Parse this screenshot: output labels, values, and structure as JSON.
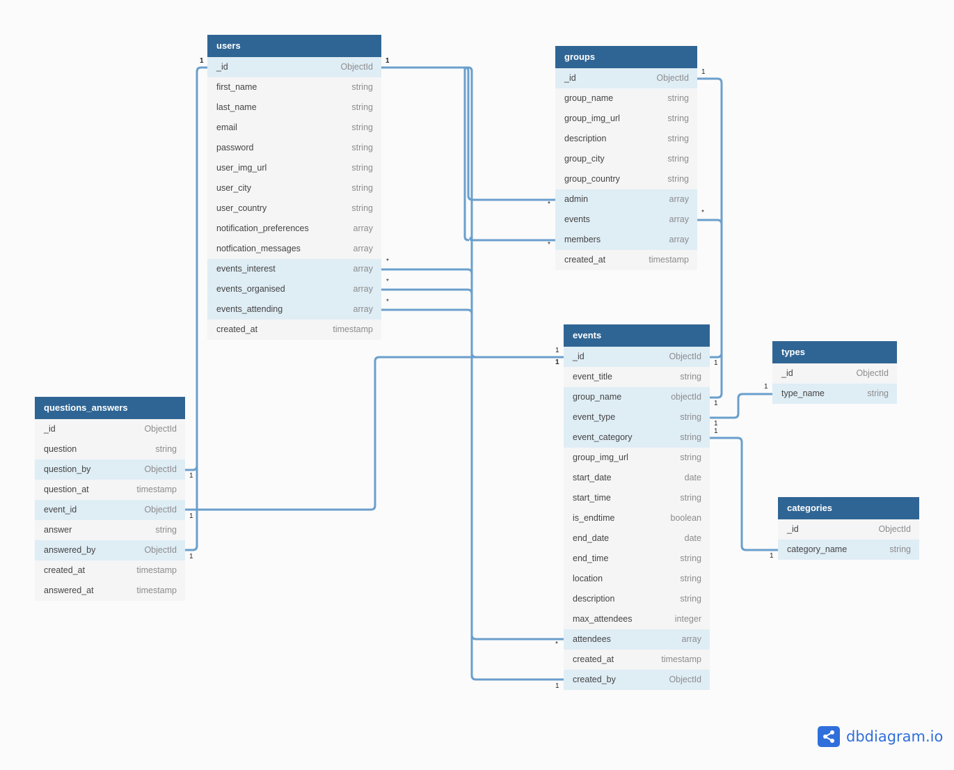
{
  "app": {
    "brand": "dbdiagram.io"
  },
  "colors": {
    "header": "#2f6594",
    "highlight_row": "#dfedf5",
    "link": "#6a9fcc",
    "brand": "#2f6fdb"
  },
  "tables": {
    "users": {
      "name": "users",
      "fields": [
        {
          "name": "_id",
          "type": "ObjectId",
          "hl": true
        },
        {
          "name": "first_name",
          "type": "string"
        },
        {
          "name": "last_name",
          "type": "string"
        },
        {
          "name": "email",
          "type": "string"
        },
        {
          "name": "password",
          "type": "string"
        },
        {
          "name": "user_img_url",
          "type": "string"
        },
        {
          "name": "user_city",
          "type": "string"
        },
        {
          "name": "user_country",
          "type": "string"
        },
        {
          "name": "notification_preferences",
          "type": "array"
        },
        {
          "name": "notfication_messages",
          "type": "array"
        },
        {
          "name": "events_interest",
          "type": "array",
          "hl": true
        },
        {
          "name": "events_organised",
          "type": "array",
          "hl": true
        },
        {
          "name": "events_attending",
          "type": "array",
          "hl": true
        },
        {
          "name": "created_at",
          "type": "timestamp"
        }
      ]
    },
    "groups": {
      "name": "groups",
      "fields": [
        {
          "name": "_id",
          "type": "ObjectId",
          "hl": true
        },
        {
          "name": "group_name",
          "type": "string"
        },
        {
          "name": "group_img_url",
          "type": "string"
        },
        {
          "name": "description",
          "type": "string"
        },
        {
          "name": "group_city",
          "type": "string"
        },
        {
          "name": "group_country",
          "type": "string"
        },
        {
          "name": "admin",
          "type": "array",
          "hl": true
        },
        {
          "name": "events",
          "type": "array",
          "hl": true
        },
        {
          "name": "members",
          "type": "array",
          "hl": true
        },
        {
          "name": "created_at",
          "type": "timestamp"
        }
      ]
    },
    "events": {
      "name": "events",
      "fields": [
        {
          "name": "_id",
          "type": "ObjectId",
          "hl": true
        },
        {
          "name": "event_title",
          "type": "string"
        },
        {
          "name": "group_name",
          "type": "objectId",
          "hl": true
        },
        {
          "name": "event_type",
          "type": "string",
          "hl": true
        },
        {
          "name": "event_category",
          "type": "string",
          "hl": true
        },
        {
          "name": "group_img_url",
          "type": "string"
        },
        {
          "name": "start_date",
          "type": "date"
        },
        {
          "name": "start_time",
          "type": "string"
        },
        {
          "name": "is_endtime",
          "type": "boolean"
        },
        {
          "name": "end_date",
          "type": "date"
        },
        {
          "name": "end_time",
          "type": "string"
        },
        {
          "name": "location",
          "type": "string"
        },
        {
          "name": "description",
          "type": "string"
        },
        {
          "name": "max_attendees",
          "type": "integer"
        },
        {
          "name": "attendees",
          "type": "array",
          "hl": true
        },
        {
          "name": "created_at",
          "type": "timestamp"
        },
        {
          "name": "created_by",
          "type": "ObjectId",
          "hl": true
        }
      ]
    },
    "types": {
      "name": "types",
      "fields": [
        {
          "name": "_id",
          "type": "ObjectId"
        },
        {
          "name": "type_name",
          "type": "string",
          "hl": true
        }
      ]
    },
    "categories": {
      "name": "categories",
      "fields": [
        {
          "name": "_id",
          "type": "ObjectId"
        },
        {
          "name": "category_name",
          "type": "string",
          "hl": true
        }
      ]
    },
    "questions_answers": {
      "name": "questions_answers",
      "fields": [
        {
          "name": "_id",
          "type": "ObjectId"
        },
        {
          "name": "question",
          "type": "string"
        },
        {
          "name": "question_by",
          "type": "ObjectId",
          "hl": true
        },
        {
          "name": "question_at",
          "type": "timestamp"
        },
        {
          "name": "event_id",
          "type": "ObjectId",
          "hl": true
        },
        {
          "name": "answer",
          "type": "string"
        },
        {
          "name": "answered_by",
          "type": "ObjectId",
          "hl": true
        },
        {
          "name": "created_at",
          "type": "timestamp"
        },
        {
          "name": "answered_at",
          "type": "timestamp"
        }
      ]
    }
  },
  "relationships": [
    {
      "from": "users._id",
      "to": "groups.admin",
      "from_card": "1",
      "to_card": "*"
    },
    {
      "from": "users._id",
      "to": "groups.members",
      "from_card": "1",
      "to_card": "*"
    },
    {
      "from": "users._id",
      "to": "events.attendees",
      "from_card": "1",
      "to_card": "*"
    },
    {
      "from": "users._id",
      "to": "events.created_by",
      "from_card": "1",
      "to_card": "1"
    },
    {
      "from": "users._id",
      "to": "questions_answers.question_by",
      "from_card": "1",
      "to_card": "1"
    },
    {
      "from": "users._id",
      "to": "questions_answers.answered_by",
      "from_card": "1",
      "to_card": "1"
    },
    {
      "from": "users.events_interest",
      "to": "events._id",
      "from_card": "*",
      "to_card": "1"
    },
    {
      "from": "users.events_organised",
      "to": "events._id",
      "from_card": "*",
      "to_card": "1"
    },
    {
      "from": "users.events_attending",
      "to": "events._id",
      "from_card": "*",
      "to_card": "1"
    },
    {
      "from": "questions_answers.event_id",
      "to": "events._id",
      "from_card": "1",
      "to_card": "1"
    },
    {
      "from": "groups._id",
      "to": "events.group_name",
      "from_card": "1",
      "to_card": "1"
    },
    {
      "from": "groups.events",
      "to": "events._id",
      "from_card": "*",
      "to_card": "1"
    },
    {
      "from": "events.event_type",
      "to": "types.type_name",
      "from_card": "1",
      "to_card": "1"
    },
    {
      "from": "events.event_category",
      "to": "categories.category_name",
      "from_card": "1",
      "to_card": "1"
    }
  ],
  "cardinality_labels": [
    {
      "id": "users-id-left",
      "text": "1"
    },
    {
      "id": "users-id-right",
      "text": "1"
    },
    {
      "id": "groups-admin",
      "text": "*"
    },
    {
      "id": "groups-members",
      "text": "*"
    },
    {
      "id": "groups-id",
      "text": "1"
    },
    {
      "id": "groups-events",
      "text": "*"
    },
    {
      "id": "users-events-interest",
      "text": "*"
    },
    {
      "id": "users-events-organised",
      "text": "*"
    },
    {
      "id": "users-events-attending",
      "text": "*"
    },
    {
      "id": "events-id-left-a",
      "text": "1"
    },
    {
      "id": "events-id-left-b",
      "text": "1"
    },
    {
      "id": "events-id-right",
      "text": "1"
    },
    {
      "id": "events-group-name",
      "text": "1"
    },
    {
      "id": "events-type",
      "text": "1"
    },
    {
      "id": "events-category",
      "text": "1"
    },
    {
      "id": "types-type-name",
      "text": "1"
    },
    {
      "id": "categories-category-name",
      "text": "1"
    },
    {
      "id": "events-attendees",
      "text": "*"
    },
    {
      "id": "events-created-by",
      "text": "1"
    },
    {
      "id": "qa-question-by",
      "text": "1"
    },
    {
      "id": "qa-event-id",
      "text": "1"
    },
    {
      "id": "qa-answered-by",
      "text": "1"
    }
  ]
}
